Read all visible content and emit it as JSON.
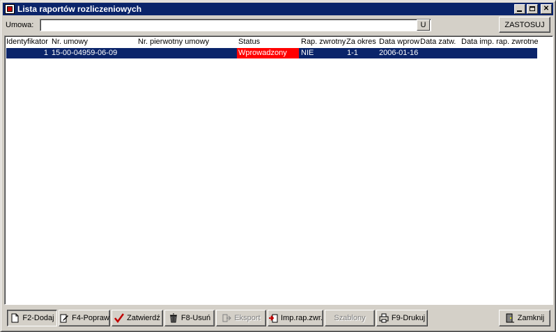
{
  "window": {
    "title": "Lista raportów rozliczeniowych"
  },
  "filter": {
    "label": "Umowa:",
    "value": "",
    "u_label": "U",
    "apply_label": "ZASTOSUJ"
  },
  "grid": {
    "columns": [
      "Identyfikator",
      "Nr. umowy",
      "Nr. pierwotny umowy",
      "Status",
      "Rap. zwrotny",
      "Za okres",
      "Data wprow",
      "Data zatw.",
      "Data imp. rap. zwrotneg"
    ],
    "rows": [
      {
        "id": "1",
        "nr_umowy": "15-00-04959-06-09",
        "nr_pierwotny": "",
        "status": "Wprowadzony",
        "rap_zwrotny": "NIE",
        "za_okres": "1-1",
        "data_wprow": "2006-01-16",
        "data_zatw": "",
        "data_imp": ""
      }
    ]
  },
  "toolbar": {
    "add": "F2-Dodaj",
    "edit": "F4-Popraw",
    "approve": "Zatwierdź",
    "delete": "F8-Usuń",
    "export": "Eksport",
    "import": "Imp.rap.zwr.",
    "templates": "Szablony",
    "print": "F9-Drukuj",
    "close": "Zamknij"
  },
  "colors": {
    "titlebar": "#0a246a",
    "selection": "#0a246a",
    "status_highlight": "#ff0000"
  }
}
